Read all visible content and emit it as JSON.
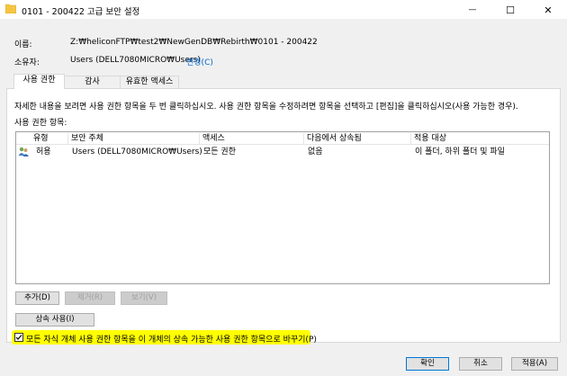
{
  "window": {
    "title": "0101 - 200422 고급 보안 설정",
    "minimize_symbol": "—",
    "maximize_symbol": "☐",
    "close_symbol": "✕"
  },
  "info": {
    "name_label": "이름:",
    "name_value": "Z:₩heliconFTP₩test2₩NewGenDB₩Rebirth₩0101 - 200422",
    "owner_label": "소유자:",
    "owner_value": "Users (DELL7080MICRO₩Users)",
    "change_link": "변경(C)"
  },
  "tabs": [
    {
      "label": "사용 권한",
      "active": true
    },
    {
      "label": "감사",
      "active": false
    },
    {
      "label": "유효한 액세스",
      "active": false
    }
  ],
  "panel": {
    "instructions": "자세한 내용을 보려면 사용 권한 항목을 두 번 클릭하십시오. 사용 권한 항목을 수정하려면 항목을 선택하고 [편집]을 클릭하십시오(사용 가능한 경우).",
    "entries_label": "사용 권한 항목:",
    "columns": [
      "유형",
      "보안 주체",
      "액세스",
      "다음에서 상속됨",
      "적용 대상"
    ],
    "rows": [
      {
        "type": "허용",
        "principal": "Users (DELL7080MICRO₩Users)",
        "access": "모든 권한",
        "inherited_from": "없음",
        "applies_to": "이 폴더, 하위 폴더 및 파일",
        "icon": "users-group-icon"
      }
    ],
    "add_button": "추가(D)",
    "remove_button": "제거(R)",
    "view_button": "보기(V)",
    "inherit_button": "상속 사용(I)"
  },
  "replace_checkbox": {
    "label": "모든 자식 개체 사용 권한 항목을 이 개체의 상속 가능한 사용 권한 항목으로 바꾸기(P)",
    "checked": true
  },
  "footer": {
    "ok": "확인",
    "cancel": "취소",
    "apply": "적용(A)"
  },
  "colors": {
    "highlight": "#ffff00",
    "link": "#0066cc",
    "folder": "#f5c542"
  }
}
